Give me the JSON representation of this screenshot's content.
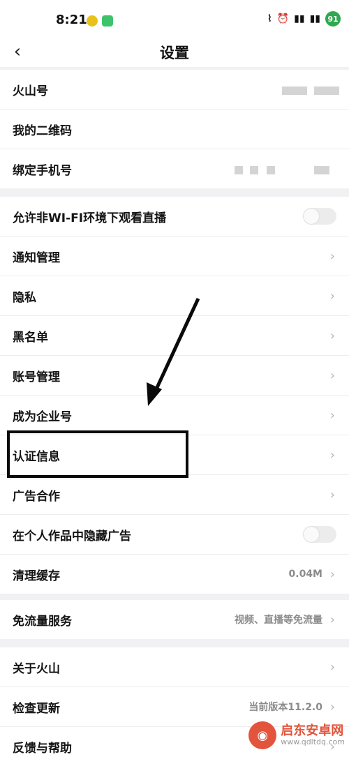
{
  "status": {
    "time": "8:21",
    "battery": "91"
  },
  "nav": {
    "back_icon": "‹",
    "title": "设置"
  },
  "groups": [
    {
      "items": [
        {
          "label": "火山号"
        },
        {
          "label": "我的二维码"
        },
        {
          "label": "绑定手机号"
        }
      ]
    },
    {
      "items": [
        {
          "label": "允许非WI-FI环境下观看直播"
        },
        {
          "label": "通知管理"
        },
        {
          "label": "隐私"
        },
        {
          "label": "黑名单"
        },
        {
          "label": "账号管理"
        },
        {
          "label": "成为企业号"
        },
        {
          "label": "认证信息"
        },
        {
          "label": "广告合作"
        },
        {
          "label": "在个人作品中隐藏广告"
        },
        {
          "label": "清理缓存",
          "value": "0.04M"
        }
      ]
    },
    {
      "items": [
        {
          "label": "免流量服务",
          "value": "视频、直播等免流量"
        }
      ]
    },
    {
      "items": [
        {
          "label": "关于火山"
        },
        {
          "label": "检查更新",
          "value": "当前版本11.2.0"
        },
        {
          "label": "反馈与帮助"
        }
      ]
    }
  ],
  "watermark": {
    "title": "启东安卓网",
    "url": "www.qdltdq.com"
  },
  "colors": {
    "accent": "#e2543b",
    "toggle_off": "#ececec",
    "chevron": "#b5b5b5"
  }
}
